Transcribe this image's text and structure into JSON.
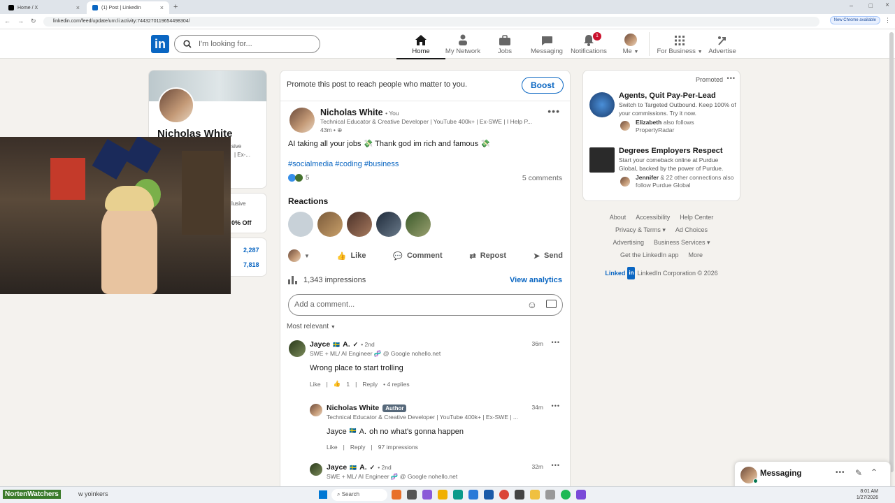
{
  "browser": {
    "tabs": [
      {
        "title": "Home / X"
      },
      {
        "title": "(1) Post | LinkedIn"
      }
    ],
    "url": "linkedin.com/feed/update/urn:li:activity:7443270119654498304/",
    "update_label": "New Chrome available"
  },
  "nav": {
    "logo": "in",
    "search_placeholder": "I'm looking for...",
    "items": [
      {
        "label": "Home"
      },
      {
        "label": "My Network"
      },
      {
        "label": "Jobs"
      },
      {
        "label": "Messaging"
      },
      {
        "label": "Notifications"
      },
      {
        "label": "Me"
      },
      {
        "label": "For Business"
      },
      {
        "label": "Advertise"
      }
    ],
    "notification_count": "1"
  },
  "profile_card": {
    "name": "Nicholas White",
    "partial1": "sive",
    "partial2": "| Ex-...",
    "partial3": "lusive",
    "partial4": "0% Off",
    "stat1": "2,287",
    "stat2": "7,818"
  },
  "post": {
    "boost_text": "Promote this post to reach people who matter to you.",
    "boost_button": "Boost",
    "author": "Nicholas White",
    "you": "• You",
    "headline": "Technical Educator & Creative Developer | YouTube 400k+ | Ex-SWE | I Help P...",
    "time": "43m •",
    "text": "AI taking all your jobs 💸 Thank god im rich and famous 💸",
    "hashtags": "#socialmedia #coding #business",
    "reaction_count": "5",
    "comments_count": "5 comments",
    "reactions_title": "Reactions",
    "actions": [
      "Like",
      "Comment",
      "Repost",
      "Send"
    ],
    "impressions": "1,343 impressions",
    "view_analytics": "View analytics",
    "comment_placeholder": "Add a comment...",
    "sort_label": "Most relevant"
  },
  "comments": [
    {
      "name": "Jayce",
      "name2": "A.",
      "degree": "• 2nd",
      "headline": "SWE + ML/ AI Engineer 🧬 @ Google nohello.net",
      "time": "36m",
      "text": "Wrong place to start trolling",
      "like": "Like",
      "like_count": "1",
      "reply": "Reply",
      "replies": "4 replies"
    },
    {
      "name": "Nicholas White",
      "author_badge": "Author",
      "headline": "Technical Educator & Creative Developer | YouTube 400k+ | Ex-SWE | ...",
      "time": "34m",
      "text_name": "Jayce",
      "text_name2": "A.",
      "text": "oh no what's gonna happen",
      "like": "Like",
      "reply": "Reply",
      "impressions": "97 impressions"
    },
    {
      "name": "Jayce",
      "name2": "A.",
      "degree": "• 2nd",
      "headline": "SWE + ML/ AI Engineer 🧬 @ Google nohello.net",
      "time": "32m"
    }
  ],
  "ads": {
    "promoted": "Promoted",
    "items": [
      {
        "title": "Agents, Quit Pay-Per-Lead",
        "desc": "Switch to Targeted Outbound. Keep 100% of your commissions. Try it now.",
        "follow_name": "Elizabeth",
        "follow_text": "also follows PropertyRadar"
      },
      {
        "title": "Degrees Employers Respect",
        "desc": "Start your comeback online at Purdue Global, backed by the power of Purdue.",
        "follow_name": "Jennifer",
        "follow_text": "& 22 other connections also follow Purdue Global"
      }
    ]
  },
  "footer": {
    "links": [
      "About",
      "Accessibility",
      "Help Center",
      "Privacy & Terms",
      "Ad Choices",
      "Advertising",
      "Business Services",
      "Get the LinkedIn app",
      "More"
    ],
    "brand": "Linked",
    "copyright": "LinkedIn Corporation © 2026"
  },
  "messaging": {
    "label": "Messaging"
  },
  "taskbar": {
    "stream_text1": "NortenWatchers",
    "stream_text2": "w yoinkers",
    "search": "Search",
    "time": "8:01 AM",
    "date": "1/27/2026"
  }
}
